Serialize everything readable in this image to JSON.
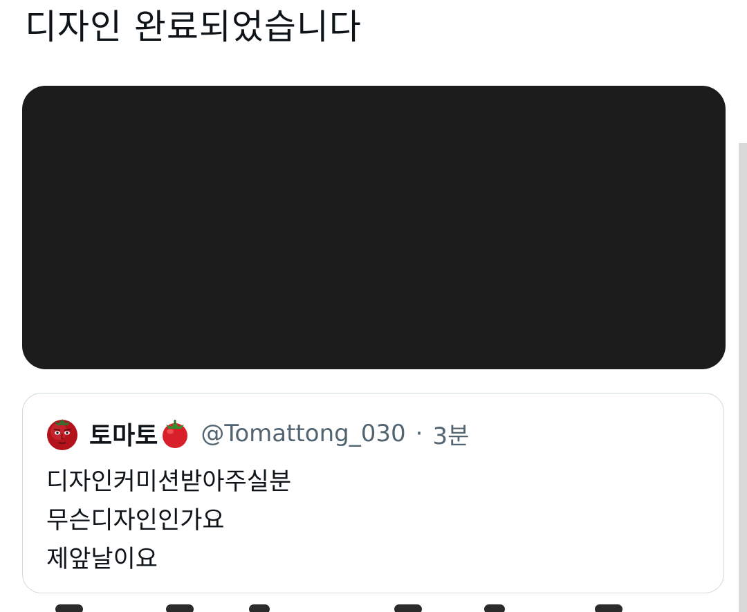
{
  "tweet": {
    "text": "디자인 완료되었습니다"
  },
  "media": {
    "alt": ""
  },
  "quote": {
    "display_name": "토마토",
    "name_emoji": "tomato-emoji",
    "avatar_icon": "tomato-avatar-icon",
    "handle": "@Tomattong_030",
    "separator": "·",
    "time": "3분",
    "lines": [
      "디자인커미션받아주실분",
      "무슨디자인인가요",
      "제앞날이요"
    ]
  },
  "colors": {
    "text_primary": "#0f1419",
    "text_secondary": "#536471",
    "border": "#cfd9de",
    "media_bg": "#1c1c1c",
    "tomato_red": "#d8202a",
    "leaf_green": "#3a8a2e"
  }
}
